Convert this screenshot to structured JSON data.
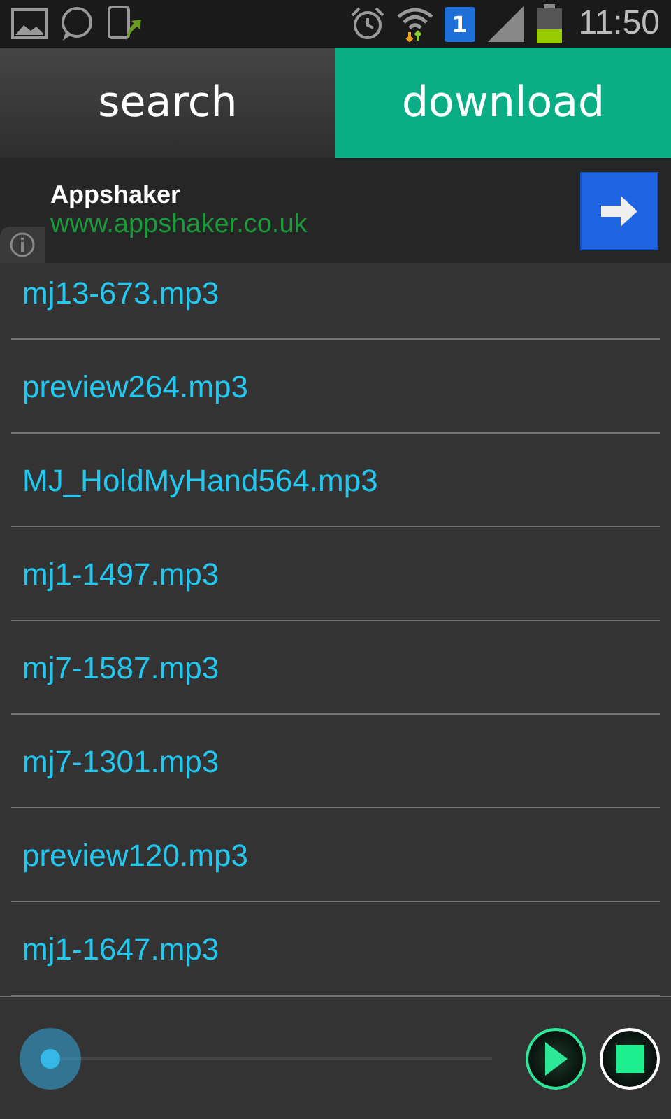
{
  "status_bar": {
    "time": "11:50",
    "sim": "1"
  },
  "tabs": [
    {
      "label": "search",
      "selected": false
    },
    {
      "label": "download",
      "selected": true
    }
  ],
  "ad": {
    "title": "Appshaker",
    "url": "www.appshaker.co.uk"
  },
  "files": [
    "mj13-673.mp3",
    "preview264.mp3",
    "MJ_HoldMyHand564.mp3",
    "mj1-1497.mp3",
    "mj7-1587.mp3",
    "mj7-1301.mp3",
    "preview120.mp3",
    "mj1-1647.mp3"
  ]
}
